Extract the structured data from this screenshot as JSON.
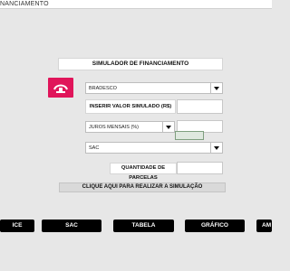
{
  "window": {
    "title": "NANCIAMENTO"
  },
  "header": {
    "title": "SIMULADOR DE FINANCIAMENTO"
  },
  "logo": {
    "icon": "bradesco-logo-icon",
    "color": "#e0155a"
  },
  "form": {
    "bank_select_value": "BRADESCO",
    "amount_label": "INSERIR VALOR SIMULADO (R$)",
    "amount_value": "",
    "interest_select_value": "JUROS MENSAIS (%)",
    "interest_value": "",
    "system_select_value": "SAC",
    "installments_label": "QUANTIDADE DE PARCELAS",
    "installments_value": ""
  },
  "actions": {
    "simulate_label": "CLIQUE AQUI PARA REALIZAR A SIMULAÇÃO"
  },
  "nav": {
    "buttons": [
      "ICE",
      "SAC",
      "TABELA",
      "GRÁFICO",
      "AM"
    ]
  }
}
